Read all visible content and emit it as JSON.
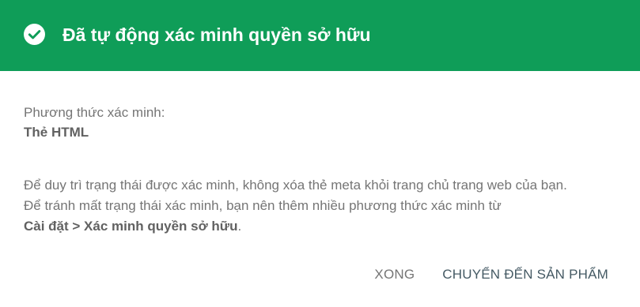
{
  "dialog": {
    "title": "Đã tự động xác minh quyền sở hữu",
    "header_color": "#0f9d58",
    "icon": "check-circle-icon"
  },
  "method": {
    "label": "Phương thức xác minh:",
    "value": "Thẻ HTML"
  },
  "info": {
    "line1": "Để duy trì trạng thái được xác minh, không xóa thẻ meta khỏi trang chủ trang web của bạn.",
    "line2": "Để tránh mất trạng thái xác minh, bạn nên thêm nhiều phương thức xác minh từ",
    "link_path": "Cài đặt > Xác minh quyền sở hữu",
    "trailing": "."
  },
  "actions": {
    "done_label": "XONG",
    "go_label": "CHUYỂN ĐẾN SẢN PHẨM"
  }
}
